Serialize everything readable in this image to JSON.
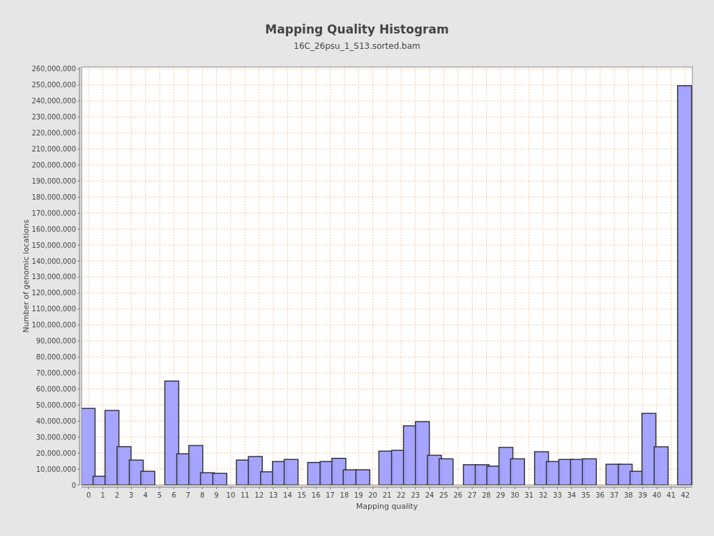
{
  "chart": {
    "subtitle": "16C_26psu_1_S13.sorted.bam",
    "chart_data": {
      "type": "bar",
      "title": "Mapping Quality Histogram",
      "xlabel": "Mapping quality",
      "ylabel": "Number of genomic locations",
      "x": [
        -0.04,
        0.8,
        1.64,
        2.49,
        3.35,
        4.16,
        5.85,
        6.69,
        7.54,
        8.36,
        9.23,
        10.89,
        11.73,
        12.59,
        13.43,
        14.25,
        15.91,
        16.78,
        17.61,
        18.41,
        19.3,
        20.92,
        21.81,
        22.65,
        23.49,
        24.34,
        25.16,
        26.87,
        27.7,
        28.52,
        29.37,
        30.19,
        31.88,
        32.71,
        33.59,
        34.41,
        35.25,
        36.91,
        37.77,
        38.6,
        39.44,
        40.3,
        41.95
      ],
      "values": [
        47900000,
        5500000,
        46600000,
        24000000,
        15600000,
        8600000,
        65000000,
        19500000,
        24700000,
        7700000,
        7300000,
        15600000,
        17800000,
        8300000,
        14700000,
        16000000,
        14100000,
        14700000,
        16700000,
        9500000,
        9500000,
        21200000,
        21700000,
        37000000,
        39600000,
        18600000,
        16400000,
        12700000,
        12700000,
        11800000,
        23500000,
        16400000,
        20800000,
        14700000,
        16000000,
        16000000,
        16400000,
        13000000,
        13000000,
        8600000,
        44800000,
        23900000,
        249600000
      ],
      "grid": true,
      "xlim": [
        -0.5,
        42.5
      ],
      "ylim": [
        0,
        261300000
      ],
      "xticks": [
        0,
        1,
        2,
        3,
        4,
        5,
        6,
        7,
        8,
        9,
        10,
        11,
        12,
        13,
        14,
        15,
        16,
        17,
        18,
        19,
        20,
        21,
        22,
        23,
        24,
        25,
        26,
        27,
        28,
        29,
        30,
        31,
        32,
        33,
        34,
        35,
        36,
        37,
        38,
        39,
        40,
        41,
        42
      ],
      "yticks": [
        {
          "value": 0,
          "label": "0"
        },
        {
          "value": 10000000,
          "label": "10,000,000"
        },
        {
          "value": 20000000,
          "label": "20,000,000"
        },
        {
          "value": 30000000,
          "label": "30,000,000"
        },
        {
          "value": 40000000,
          "label": "40,000,000"
        },
        {
          "value": 50000000,
          "label": "50,000,000"
        },
        {
          "value": 60000000,
          "label": "60,000,000"
        },
        {
          "value": 70000000,
          "label": "70,000,000"
        },
        {
          "value": 80000000,
          "label": "80,000,000"
        },
        {
          "value": 90000000,
          "label": "90,000,000"
        },
        {
          "value": 100000000,
          "label": "100,000,000"
        },
        {
          "value": 110000000,
          "label": "110,000,000"
        },
        {
          "value": 120000000,
          "label": "120,000,000"
        },
        {
          "value": 130000000,
          "label": "130,000,000"
        },
        {
          "value": 140000000,
          "label": "140,000,000"
        },
        {
          "value": 150000000,
          "label": "150,000,000"
        },
        {
          "value": 160000000,
          "label": "160,000,000"
        },
        {
          "value": 170000000,
          "label": "170,000,000"
        },
        {
          "value": 180000000,
          "label": "180,000,000"
        },
        {
          "value": 190000000,
          "label": "190,000,000"
        },
        {
          "value": 200000000,
          "label": "200,000,000"
        },
        {
          "value": 210000000,
          "label": "210,000,000"
        },
        {
          "value": 220000000,
          "label": "220,000,000"
        },
        {
          "value": 230000000,
          "label": "230,000,000"
        },
        {
          "value": 240000000,
          "label": "240,000,000"
        },
        {
          "value": 250000000,
          "label": "250,000,000"
        },
        {
          "value": 260000000,
          "label": "260,000,000"
        }
      ]
    }
  }
}
